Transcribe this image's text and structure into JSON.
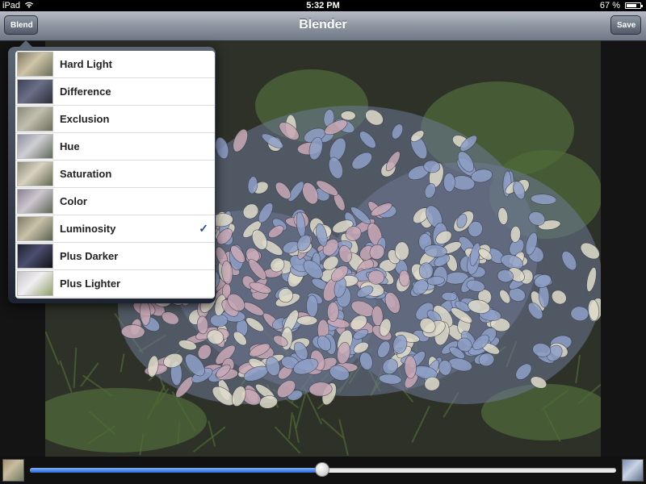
{
  "status_bar": {
    "device": "iPad",
    "time": "5:32 PM",
    "battery": "67 %"
  },
  "nav_bar": {
    "title": "Blender",
    "left_button": "Blend",
    "right_button": "Save"
  },
  "blend_menu": {
    "items": [
      {
        "label": "Hard Light",
        "selected": false,
        "thumb_colors": [
          "#7e7560",
          "#cfc5a8",
          "#6a6f5a"
        ]
      },
      {
        "label": "Difference",
        "selected": false,
        "thumb_colors": [
          "#3d4254",
          "#6a6f86",
          "#2a2e38"
        ]
      },
      {
        "label": "Exclusion",
        "selected": false,
        "thumb_colors": [
          "#8a8a78",
          "#c2bfae",
          "#6c6e5e"
        ]
      },
      {
        "label": "Hue",
        "selected": false,
        "thumb_colors": [
          "#8a8fa0",
          "#d0cfd4",
          "#5f6a58"
        ]
      },
      {
        "label": "Saturation",
        "selected": false,
        "thumb_colors": [
          "#8b8a78",
          "#d9d2c0",
          "#606850"
        ]
      },
      {
        "label": "Color",
        "selected": false,
        "thumb_colors": [
          "#8a8090",
          "#cdc6cf",
          "#5d6655"
        ]
      },
      {
        "label": "Luminosity",
        "selected": true,
        "thumb_colors": [
          "#7d7866",
          "#c9c2aa",
          "#5b6150"
        ]
      },
      {
        "label": "Plus Darker",
        "selected": false,
        "thumb_colors": [
          "#1d2030",
          "#4b4f6e",
          "#101216"
        ]
      },
      {
        "label": "Plus Lighter",
        "selected": false,
        "thumb_colors": [
          "#c5c5c8",
          "#f0eef0",
          "#90a068"
        ]
      }
    ],
    "check_glyph": "✓"
  },
  "photo": {
    "description_colors": [
      "#8fa0c8",
      "#c9a9b6",
      "#e0dccb",
      "#4f6a3a"
    ]
  },
  "slider": {
    "value_fraction": 0.498,
    "fill_color": "#2a68d8"
  }
}
